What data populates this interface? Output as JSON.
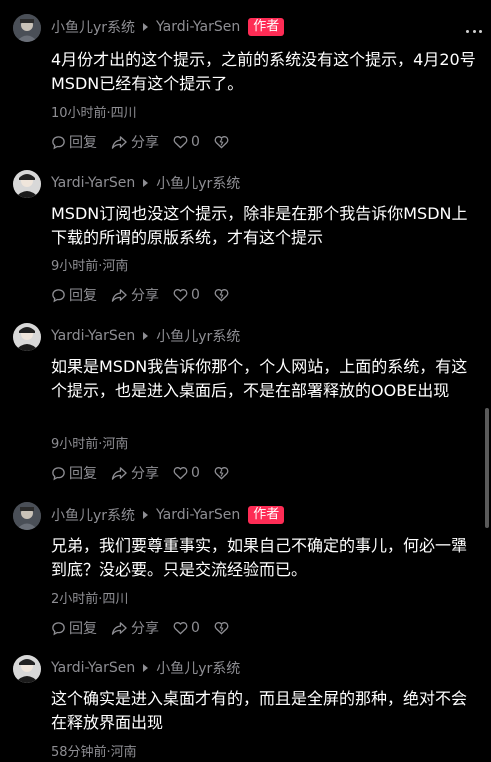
{
  "thread": {
    "comments": [
      {
        "author": "小鱼儿yr系统",
        "reply_to": "Yardi-YarSen",
        "author_tag": "作者",
        "text": "4月份才出的这个提示，之前的系统没有这个提示，4月20号MSDN已经有这个提示了。",
        "meta": "10小时前·四川",
        "reply_label": "回复",
        "share_label": "分享",
        "like_count": "0"
      },
      {
        "author": "Yardi-YarSen",
        "reply_to": "小鱼儿yr系统",
        "text": "MSDN订阅也没这个提示，除非是在那个我告诉你MSDN上下载的所谓的原版系统，才有这个提示",
        "meta": "9小时前·河南",
        "reply_label": "回复",
        "share_label": "分享",
        "like_count": "0"
      },
      {
        "author": "Yardi-YarSen",
        "reply_to": "小鱼儿yr系统",
        "text": "如果是MSDN我告诉你那个，个人网站，上面的系统，有这个提示，也是进入桌面后，不是在部署释放的OOBE出现",
        "meta": "9小时前·河南",
        "reply_label": "回复",
        "share_label": "分享",
        "like_count": "0"
      },
      {
        "author": "小鱼儿yr系统",
        "reply_to": "Yardi-YarSen",
        "author_tag": "作者",
        "text": "兄弟，我们要尊重事实，如果自己不确定的事儿，何必一犟到底？没必要。只是交流经验而已。",
        "meta": "2小时前·四川",
        "reply_label": "回复",
        "share_label": "分享",
        "like_count": "0"
      },
      {
        "author": "Yardi-YarSen",
        "reply_to": "小鱼儿yr系统",
        "text": "这个确实是进入桌面才有的，而且是全屏的那种，绝对不会在释放界面出现",
        "meta": "58分钟前·河南"
      }
    ]
  },
  "colors": {
    "background": "#000000",
    "text": "#ffffff",
    "secondary_text": "#8e8e93",
    "author_tag": "#fe2c55"
  },
  "icons": [
    "more-icon",
    "reply-icon",
    "share-icon",
    "like-icon",
    "dislike-icon",
    "chevron-right-icon"
  ]
}
